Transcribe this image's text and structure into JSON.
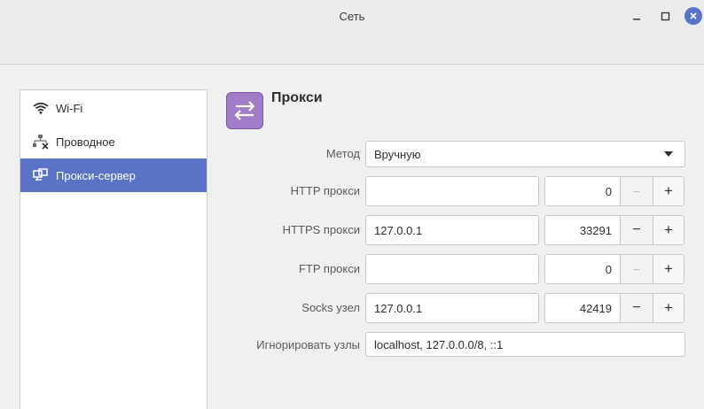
{
  "window": {
    "title": "Сеть",
    "minimize_icon": "minimize-icon",
    "maximize_icon": "maximize-icon",
    "close_icon": "close-icon",
    "accent_color": "#5b73c7"
  },
  "sidebar": {
    "items": [
      {
        "label": "Wi-Fi",
        "icon": "wifi-icon",
        "active": false
      },
      {
        "label": "Проводное",
        "icon": "wired-network-icon",
        "active": false
      },
      {
        "label": "Прокси-сервер",
        "icon": "proxy-icon",
        "active": true
      }
    ]
  },
  "main": {
    "title": "Прокси",
    "icon": "proxy-arrows-icon",
    "method": {
      "label": "Метод",
      "value": "Вручную"
    },
    "http": {
      "label": "HTTP прокси",
      "host": "",
      "port": "0"
    },
    "https": {
      "label": "HTTPS прокси",
      "host": "127.0.0.1",
      "port": "33291"
    },
    "ftp": {
      "label": "FTP прокси",
      "host": "",
      "port": "0"
    },
    "socks": {
      "label": "Socks узел",
      "host": "127.0.0.1",
      "port": "42419"
    },
    "ignore": {
      "label": "Игнорировать узлы",
      "value": "localhost, 127.0.0.0/8, ::1"
    },
    "stepper": {
      "minus": "−",
      "plus": "+"
    }
  }
}
